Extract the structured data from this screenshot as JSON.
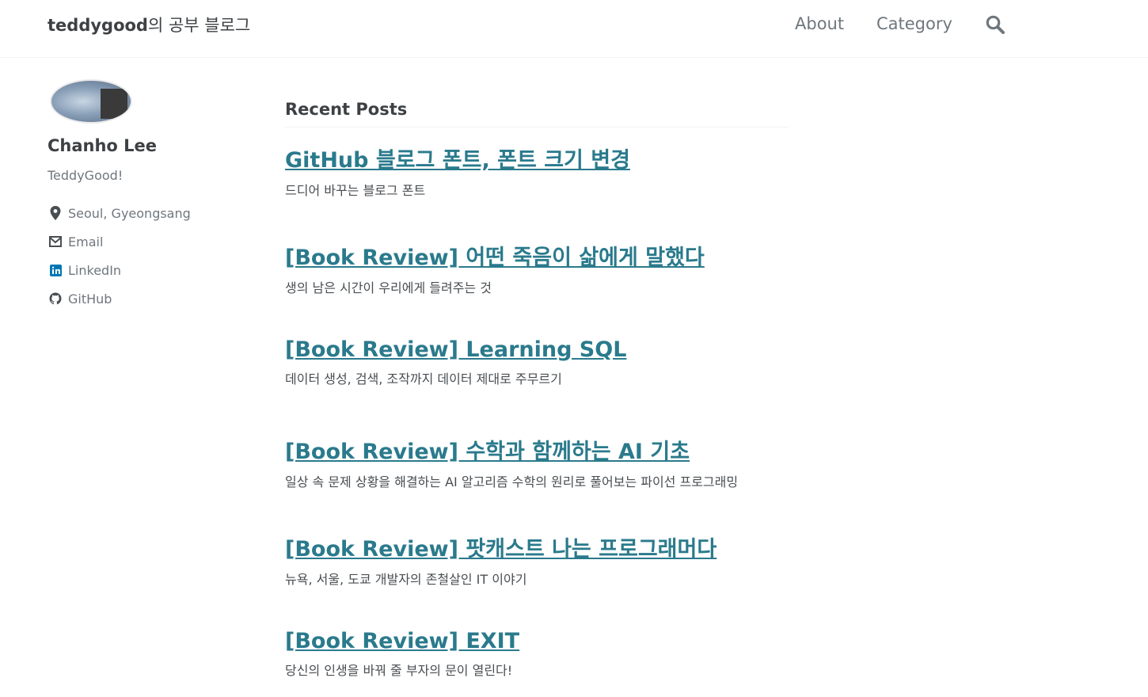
{
  "masthead": {
    "site_title_bold": "teddygood",
    "site_title_rest": "의 공부 블로그",
    "nav": [
      {
        "label": "About"
      },
      {
        "label": "Category"
      }
    ],
    "search_icon": "search-icon"
  },
  "sidebar": {
    "author_name": "Chanho Lee",
    "author_bio": "TeddyGood!",
    "links": [
      {
        "icon": "location-pin-icon",
        "label": "Seoul, Gyeongsang"
      },
      {
        "icon": "envelope-icon",
        "label": "Email"
      },
      {
        "icon": "linkedin-icon",
        "label": "LinkedIn",
        "color": "#0077b5"
      },
      {
        "icon": "github-icon",
        "label": "GitHub"
      }
    ]
  },
  "main": {
    "section_title": "Recent Posts",
    "posts": [
      {
        "title": "GitHub 블로그 폰트, 폰트 크기 변경",
        "excerpt": "드디어 바꾸는 블로그 폰트"
      },
      {
        "title": "[Book Review] 어떤 죽음이 삶에게 말했다",
        "excerpt": "생의 남은 시간이 우리에게 들려주는 것"
      },
      {
        "title": "[Book Review] Learning SQL",
        "excerpt": "데이터 생성, 검색, 조작까지 데이터 제대로 주무르기"
      },
      {
        "title": "[Book Review] 수학과 함께하는 AI 기초",
        "excerpt": "일상 속 문제 상황을 해결하는 AI 알고리즘 수학의 원리로 풀어보는 파이선 프로그래밍"
      },
      {
        "title": "[Book Review] 팟캐스트 나는 프로그래머다",
        "excerpt": "뉴욕, 서울, 도쿄 개발자의 존철살인 IT 이야기"
      },
      {
        "title": "[Book Review] EXIT",
        "excerpt": "당신의 인생을 바꿔 줄 부자의 문이 열린다!"
      }
    ]
  },
  "colors": {
    "link": "#2a7a8c",
    "text": "#494e52",
    "muted": "#6f777d",
    "linkedin": "#0077b5"
  }
}
